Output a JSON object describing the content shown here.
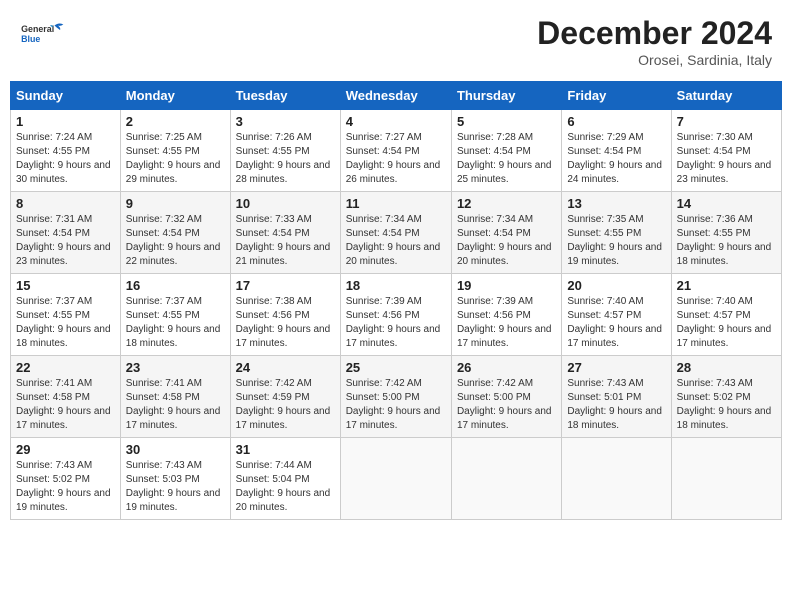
{
  "header": {
    "logo_general": "General",
    "logo_blue": "Blue",
    "month_title": "December 2024",
    "location": "Orosei, Sardinia, Italy"
  },
  "weekdays": [
    "Sunday",
    "Monday",
    "Tuesday",
    "Wednesday",
    "Thursday",
    "Friday",
    "Saturday"
  ],
  "weeks": [
    [
      {
        "day": "1",
        "sunrise": "7:24 AM",
        "sunset": "4:55 PM",
        "daylight": "9 hours and 30 minutes."
      },
      {
        "day": "2",
        "sunrise": "7:25 AM",
        "sunset": "4:55 PM",
        "daylight": "9 hours and 29 minutes."
      },
      {
        "day": "3",
        "sunrise": "7:26 AM",
        "sunset": "4:55 PM",
        "daylight": "9 hours and 28 minutes."
      },
      {
        "day": "4",
        "sunrise": "7:27 AM",
        "sunset": "4:54 PM",
        "daylight": "9 hours and 26 minutes."
      },
      {
        "day": "5",
        "sunrise": "7:28 AM",
        "sunset": "4:54 PM",
        "daylight": "9 hours and 25 minutes."
      },
      {
        "day": "6",
        "sunrise": "7:29 AM",
        "sunset": "4:54 PM",
        "daylight": "9 hours and 24 minutes."
      },
      {
        "day": "7",
        "sunrise": "7:30 AM",
        "sunset": "4:54 PM",
        "daylight": "9 hours and 23 minutes."
      }
    ],
    [
      {
        "day": "8",
        "sunrise": "7:31 AM",
        "sunset": "4:54 PM",
        "daylight": "9 hours and 23 minutes."
      },
      {
        "day": "9",
        "sunrise": "7:32 AM",
        "sunset": "4:54 PM",
        "daylight": "9 hours and 22 minutes."
      },
      {
        "day": "10",
        "sunrise": "7:33 AM",
        "sunset": "4:54 PM",
        "daylight": "9 hours and 21 minutes."
      },
      {
        "day": "11",
        "sunrise": "7:34 AM",
        "sunset": "4:54 PM",
        "daylight": "9 hours and 20 minutes."
      },
      {
        "day": "12",
        "sunrise": "7:34 AM",
        "sunset": "4:54 PM",
        "daylight": "9 hours and 20 minutes."
      },
      {
        "day": "13",
        "sunrise": "7:35 AM",
        "sunset": "4:55 PM",
        "daylight": "9 hours and 19 minutes."
      },
      {
        "day": "14",
        "sunrise": "7:36 AM",
        "sunset": "4:55 PM",
        "daylight": "9 hours and 18 minutes."
      }
    ],
    [
      {
        "day": "15",
        "sunrise": "7:37 AM",
        "sunset": "4:55 PM",
        "daylight": "9 hours and 18 minutes."
      },
      {
        "day": "16",
        "sunrise": "7:37 AM",
        "sunset": "4:55 PM",
        "daylight": "9 hours and 18 minutes."
      },
      {
        "day": "17",
        "sunrise": "7:38 AM",
        "sunset": "4:56 PM",
        "daylight": "9 hours and 17 minutes."
      },
      {
        "day": "18",
        "sunrise": "7:39 AM",
        "sunset": "4:56 PM",
        "daylight": "9 hours and 17 minutes."
      },
      {
        "day": "19",
        "sunrise": "7:39 AM",
        "sunset": "4:56 PM",
        "daylight": "9 hours and 17 minutes."
      },
      {
        "day": "20",
        "sunrise": "7:40 AM",
        "sunset": "4:57 PM",
        "daylight": "9 hours and 17 minutes."
      },
      {
        "day": "21",
        "sunrise": "7:40 AM",
        "sunset": "4:57 PM",
        "daylight": "9 hours and 17 minutes."
      }
    ],
    [
      {
        "day": "22",
        "sunrise": "7:41 AM",
        "sunset": "4:58 PM",
        "daylight": "9 hours and 17 minutes."
      },
      {
        "day": "23",
        "sunrise": "7:41 AM",
        "sunset": "4:58 PM",
        "daylight": "9 hours and 17 minutes."
      },
      {
        "day": "24",
        "sunrise": "7:42 AM",
        "sunset": "4:59 PM",
        "daylight": "9 hours and 17 minutes."
      },
      {
        "day": "25",
        "sunrise": "7:42 AM",
        "sunset": "5:00 PM",
        "daylight": "9 hours and 17 minutes."
      },
      {
        "day": "26",
        "sunrise": "7:42 AM",
        "sunset": "5:00 PM",
        "daylight": "9 hours and 17 minutes."
      },
      {
        "day": "27",
        "sunrise": "7:43 AM",
        "sunset": "5:01 PM",
        "daylight": "9 hours and 18 minutes."
      },
      {
        "day": "28",
        "sunrise": "7:43 AM",
        "sunset": "5:02 PM",
        "daylight": "9 hours and 18 minutes."
      }
    ],
    [
      {
        "day": "29",
        "sunrise": "7:43 AM",
        "sunset": "5:02 PM",
        "daylight": "9 hours and 19 minutes."
      },
      {
        "day": "30",
        "sunrise": "7:43 AM",
        "sunset": "5:03 PM",
        "daylight": "9 hours and 19 minutes."
      },
      {
        "day": "31",
        "sunrise": "7:44 AM",
        "sunset": "5:04 PM",
        "daylight": "9 hours and 20 minutes."
      },
      null,
      null,
      null,
      null
    ]
  ],
  "labels": {
    "sunrise": "Sunrise:",
    "sunset": "Sunset:",
    "daylight": "Daylight:"
  }
}
